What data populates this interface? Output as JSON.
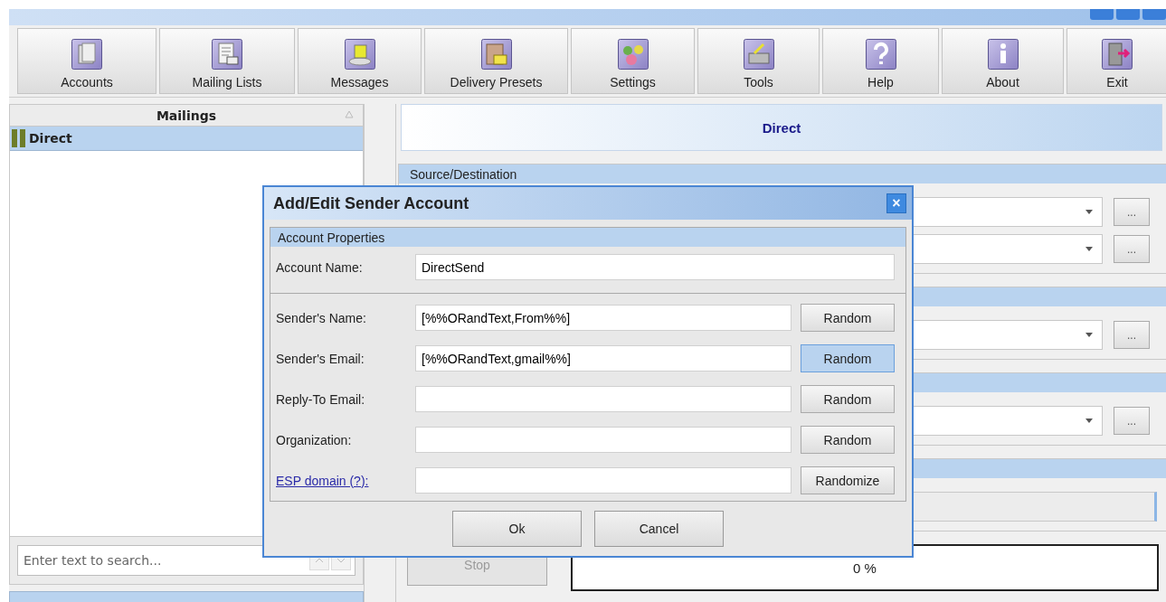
{
  "toolbar": [
    {
      "label": "Accounts"
    },
    {
      "label": "Mailing Lists"
    },
    {
      "label": "Messages"
    },
    {
      "label": "Delivery Presets"
    },
    {
      "label": "Settings"
    },
    {
      "label": "Tools"
    },
    {
      "label": "Help"
    },
    {
      "label": "About"
    },
    {
      "label": "Exit"
    }
  ],
  "mailings": {
    "title": "Mailings",
    "items": [
      {
        "label": "Direct",
        "selected": true
      }
    ],
    "search": {
      "placeholder": "Enter text to search..."
    }
  },
  "mailing": {
    "title": "Direct",
    "sections": [
      {
        "kind": "combos",
        "title": "Source/Destination",
        "buttons": [
          "...",
          "..."
        ]
      },
      {
        "kind": "combos",
        "buttons": [
          "..."
        ]
      },
      {
        "kind": "combos",
        "buttons": [
          "..."
        ]
      },
      {
        "kind": "field"
      }
    ],
    "stop": {
      "label": "Stop",
      "disabled": true
    },
    "progress": {
      "reading": "0 %",
      "level": 0
    }
  },
  "dialog": {
    "title": "Add/Edit Sender Account",
    "close": "×",
    "group": "Account Properties",
    "account_name": {
      "label": "Account Name:",
      "value": "DirectSend"
    },
    "fields": [
      {
        "kind": "text",
        "label": "Sender's Name:",
        "value": "[%%ORandText,From%%]",
        "button": {
          "label": "Random",
          "highlighted": false
        }
      },
      {
        "kind": "text",
        "label": "Sender's Email:",
        "value": "[%%ORandText,gmail%%]",
        "button": {
          "label": "Random",
          "highlighted": true
        }
      },
      {
        "kind": "text",
        "label": "Reply-To Email:",
        "button": {
          "label": "Random",
          "highlighted": false
        }
      },
      {
        "kind": "text",
        "label": "Organization:",
        "button": {
          "label": "Random",
          "highlighted": false
        }
      },
      {
        "kind": "link",
        "label": "ESP domain (?):",
        "button": {
          "label": "Randomize",
          "highlighted": false
        }
      }
    ],
    "buttons": [
      "Ok",
      "Cancel"
    ]
  }
}
